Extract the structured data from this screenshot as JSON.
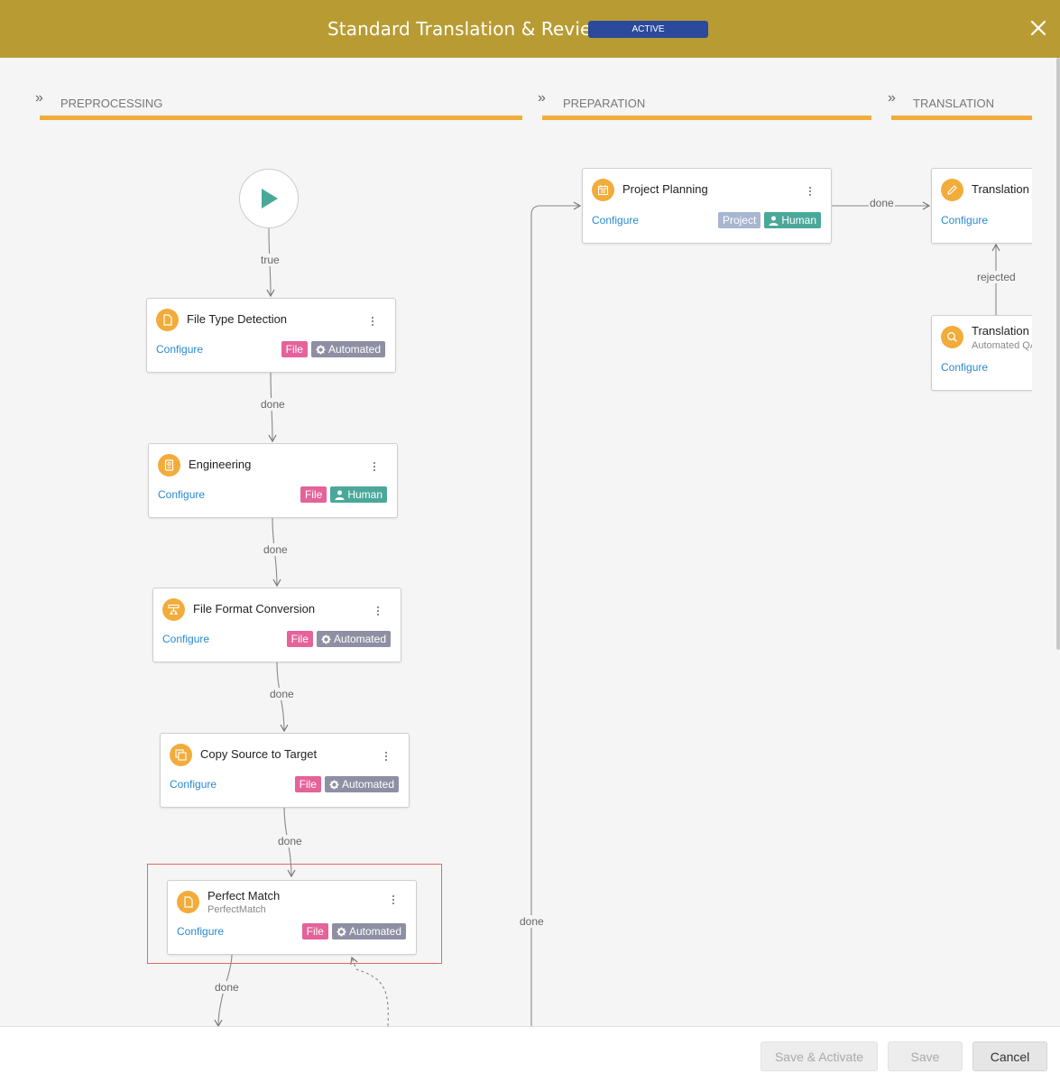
{
  "header": {
    "title": "Standard Translation & Review",
    "status": "ACTIVE"
  },
  "stages": [
    {
      "label": "PREPROCESSING"
    },
    {
      "label": "PREPARATION"
    },
    {
      "label": "TRANSLATION"
    }
  ],
  "edges": {
    "start_to_ftd": "true",
    "ftd_to_eng": "done",
    "eng_to_ffc": "done",
    "ffc_to_cst": "done",
    "cst_to_pm": "done",
    "pm_out": "done",
    "to_planning": "done",
    "planning_to_translation": "done",
    "qa_to_translation": "rejected"
  },
  "nodes": {
    "file_type_detection": {
      "title": "File Type Detection",
      "configure": "Configure",
      "tags": [
        "File",
        "Automated"
      ]
    },
    "engineering": {
      "title": "Engineering",
      "configure": "Configure",
      "tags": [
        "File",
        "Human"
      ]
    },
    "file_format_conversion": {
      "title": "File Format Conversion",
      "configure": "Configure",
      "tags": [
        "File",
        "Automated"
      ]
    },
    "copy_source_to_target": {
      "title": "Copy Source to Target",
      "configure": "Configure",
      "tags": [
        "File",
        "Automated"
      ]
    },
    "perfect_match": {
      "title": "Perfect Match",
      "subtitle": "PerfectMatch",
      "configure": "Configure",
      "tags": [
        "File",
        "Automated"
      ]
    },
    "project_planning": {
      "title": "Project Planning",
      "configure": "Configure",
      "tags": [
        "Project",
        "Human"
      ]
    },
    "translation": {
      "title": "Translation",
      "configure": "Configure"
    },
    "translation_qa": {
      "title": "Translation",
      "subtitle": "Automated QA",
      "configure": "Configure"
    }
  },
  "footer": {
    "save_activate": "Save & Activate",
    "save": "Save",
    "cancel": "Cancel"
  },
  "colors": {
    "header": "#b89c33",
    "accent": "#f2ac3b",
    "badge": "#2b4a9c",
    "file_tag": "#e5629a",
    "automated_tag": "#8e8fa3",
    "human_tag": "#4aa89a",
    "project_tag": "#a8b6d1",
    "link": "#2a8ad1"
  }
}
